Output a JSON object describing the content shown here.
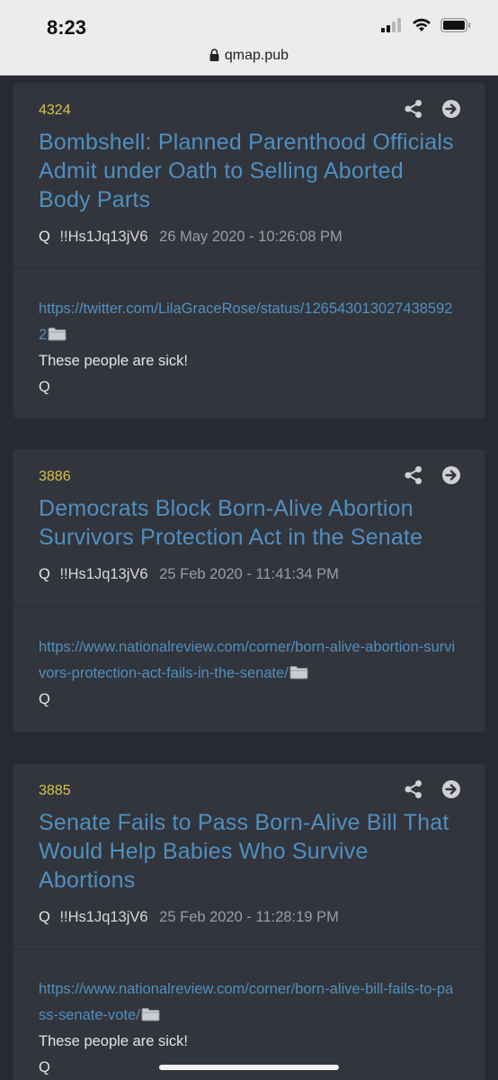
{
  "status_bar": {
    "time": "8:23"
  },
  "address_bar": {
    "url": "qmap.pub"
  },
  "posts": [
    {
      "number": "4324",
      "title": "Bombshell: Planned Parenthood Officials Admit under Oath to Selling Aborted Body Parts",
      "author": "Q",
      "tripcode": "!!Hs1Jq13jV6",
      "date": "26 May 2020 - 10:26:08 PM",
      "link": "https://twitter.com/LilaGraceRose/status/1265430130274385922",
      "text": "These people are sick!",
      "signature": "Q"
    },
    {
      "number": "3886",
      "title": "Democrats Block Born-Alive Abortion Survivors Protection Act in the Senate",
      "author": "Q",
      "tripcode": "!!Hs1Jq13jV6",
      "date": "25 Feb 2020 - 11:41:34 PM",
      "link": "https://www.nationalreview.com/corner/born-alive-abortion-survivors-protection-act-fails-in-the-senate/",
      "signature": "Q"
    },
    {
      "number": "3885",
      "title": "Senate Fails to Pass Born-Alive Bill That Would Help Babies Who Survive Abortions",
      "author": "Q",
      "tripcode": "!!Hs1Jq13jV6",
      "date": "25 Feb 2020 - 11:28:19 PM",
      "link": "https://www.nationalreview.com/corner/born-alive-bill-fails-to-pass-senate-vote/",
      "text": "These people are sick!",
      "signature": "Q"
    }
  ],
  "icons": [
    "lock-icon",
    "signal-icon",
    "wifi-icon",
    "battery-icon",
    "share-icon",
    "arrow-right-circle-icon",
    "folder-icon"
  ],
  "colors": {
    "post_number": "#d6c348",
    "link": "#4f8fc0",
    "card_bg": "#32353c",
    "page_bg": "#272a30"
  }
}
